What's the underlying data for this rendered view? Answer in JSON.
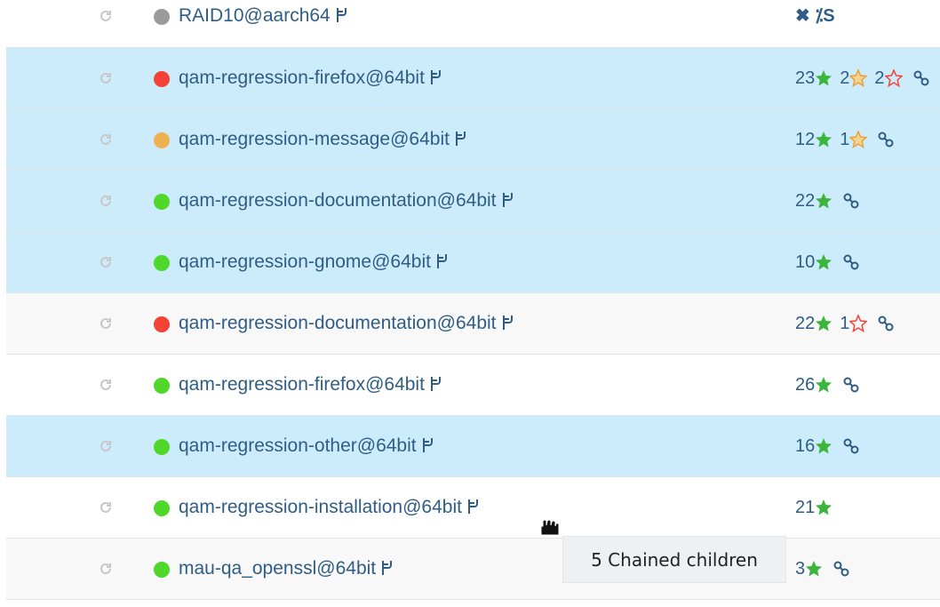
{
  "rows": [
    {
      "status": "grey",
      "name": "RAID10@aarch64",
      "results_text": "✖ ⁒S"
    },
    {
      "status": "red",
      "name": "qam-regression-firefox@64bit",
      "passed": "23",
      "softfail": "2",
      "failed": "2"
    },
    {
      "status": "orange",
      "name": "qam-regression-message@64bit",
      "passed": "12",
      "softfail": "1"
    },
    {
      "status": "green",
      "name": "qam-regression-documentation@64bit",
      "passed": "22"
    },
    {
      "status": "green",
      "name": "qam-regression-gnome@64bit",
      "passed": "10"
    },
    {
      "status": "red",
      "name": "qam-regression-documentation@64bit",
      "passed": "22",
      "failed": "1"
    },
    {
      "status": "green",
      "name": "qam-regression-firefox@64bit",
      "passed": "26"
    },
    {
      "status": "green",
      "name": "qam-regression-other@64bit",
      "passed": "16"
    },
    {
      "status": "green",
      "name": "qam-regression-installation@64bit",
      "passed": "21"
    },
    {
      "status": "green",
      "name": "mau-qa_openssl@64bit",
      "passed": "3"
    }
  ],
  "tooltip": {
    "text": "5 Chained children"
  },
  "colors": {
    "link": "#2f5d85",
    "star_pass": "#3cb53c",
    "star_softfail": "#e6a23c",
    "star_fail": "#f44336",
    "row_highlight": "#cdecfb"
  },
  "icons": {
    "restart": "restart-icon",
    "branch": "branch-icon",
    "star": "star-icon",
    "chain": "chain-link-icon",
    "hand": "hand-cursor-icon"
  }
}
